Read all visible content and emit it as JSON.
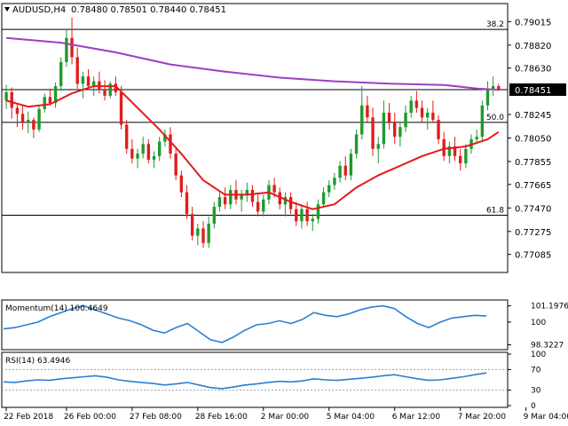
{
  "chart_data": {
    "type": "candlestick",
    "symbol_label": "AUDUSD,H4",
    "ohlc_label": "0.78480 0.78501 0.78440 0.78451",
    "colors": {
      "bull": "#1f9a2e",
      "bear": "#e11d1d",
      "ma_fast": "#e31b1b",
      "ma_slow": "#9b3fc6",
      "momentum": "#2b7fd4",
      "rsi": "#2b7fd4",
      "current_price_box": "#000000"
    },
    "price_axis": {
      "range": [
        0.7695,
        0.7915
      ],
      "ticks": [
        "0.79015",
        "0.78820",
        "0.78630",
        "0.78451",
        "0.78245",
        "0.78050",
        "0.77855",
        "0.77665",
        "0.77470",
        "0.77275",
        "0.77085"
      ],
      "tick_values": [
        0.79015,
        0.7882,
        0.7863,
        0.78451,
        0.78245,
        0.7805,
        0.77855,
        0.77665,
        0.7747,
        0.77275,
        0.77085
      ],
      "current_price": 0.78451
    },
    "fib_levels": [
      {
        "label": "38.2",
        "value": 0.7895
      },
      {
        "label": "50.0",
        "value": 0.7818
      },
      {
        "label": "61.8",
        "value": 0.7741
      }
    ],
    "time_axis": {
      "labels": [
        "22 Feb 2018",
        "26 Feb 00:00",
        "27 Feb 08:00",
        "28 Feb 16:00",
        "2 Mar 00:00",
        "5 Mar 04:00",
        "6 Mar 12:00",
        "7 Mar 20:00",
        "9 Mar 04:00"
      ],
      "label_index": [
        0,
        11,
        23,
        35,
        47,
        59,
        71,
        83,
        95
      ]
    },
    "candles": [
      [
        0.7836,
        0.7849,
        0.7829,
        0.7843
      ],
      [
        0.7843,
        0.7847,
        0.7821,
        0.783
      ],
      [
        0.783,
        0.7834,
        0.7814,
        0.7825
      ],
      [
        0.7825,
        0.7832,
        0.7812,
        0.7818
      ],
      [
        0.7818,
        0.7827,
        0.7809,
        0.782
      ],
      [
        0.782,
        0.7822,
        0.7805,
        0.7812
      ],
      [
        0.7812,
        0.7832,
        0.781,
        0.7829
      ],
      [
        0.7829,
        0.7842,
        0.7826,
        0.7839
      ],
      [
        0.7839,
        0.7846,
        0.7832,
        0.7834
      ],
      [
        0.7834,
        0.7851,
        0.783,
        0.7848
      ],
      [
        0.7848,
        0.7872,
        0.7844,
        0.7868
      ],
      [
        0.7868,
        0.7895,
        0.7864,
        0.7888
      ],
      [
        0.7888,
        0.7905,
        0.7866,
        0.7872
      ],
      [
        0.7872,
        0.788,
        0.7846,
        0.785
      ],
      [
        0.785,
        0.786,
        0.7838,
        0.7856
      ],
      [
        0.7856,
        0.7862,
        0.7845,
        0.7848
      ],
      [
        0.7848,
        0.7856,
        0.784,
        0.7852
      ],
      [
        0.7852,
        0.786,
        0.7842,
        0.7845
      ],
      [
        0.7845,
        0.7853,
        0.7836,
        0.784
      ],
      [
        0.784,
        0.7852,
        0.7838,
        0.785
      ],
      [
        0.785,
        0.7856,
        0.784,
        0.7843
      ],
      [
        0.7843,
        0.7848,
        0.7812,
        0.7816
      ],
      [
        0.7816,
        0.782,
        0.7792,
        0.7796
      ],
      [
        0.7796,
        0.7804,
        0.7784,
        0.7788
      ],
      [
        0.7788,
        0.7796,
        0.778,
        0.7792
      ],
      [
        0.7792,
        0.7806,
        0.7788,
        0.78
      ],
      [
        0.78,
        0.7804,
        0.7784,
        0.7787
      ],
      [
        0.7787,
        0.7794,
        0.778,
        0.779
      ],
      [
        0.779,
        0.7806,
        0.7786,
        0.7802
      ],
      [
        0.7802,
        0.7812,
        0.7798,
        0.7808
      ],
      [
        0.7808,
        0.7814,
        0.7788,
        0.7792
      ],
      [
        0.7792,
        0.7796,
        0.777,
        0.7774
      ],
      [
        0.7774,
        0.7778,
        0.7756,
        0.776
      ],
      [
        0.776,
        0.7766,
        0.7738,
        0.7742
      ],
      [
        0.7742,
        0.7748,
        0.772,
        0.7724
      ],
      [
        0.7724,
        0.7734,
        0.7716,
        0.773
      ],
      [
        0.773,
        0.7736,
        0.7714,
        0.7718
      ],
      [
        0.7718,
        0.774,
        0.7714,
        0.7734
      ],
      [
        0.7734,
        0.7752,
        0.773,
        0.7748
      ],
      [
        0.7748,
        0.776,
        0.7744,
        0.7756
      ],
      [
        0.7756,
        0.7764,
        0.7746,
        0.775
      ],
      [
        0.775,
        0.7766,
        0.7746,
        0.7762
      ],
      [
        0.7762,
        0.777,
        0.775,
        0.7754
      ],
      [
        0.7754,
        0.7762,
        0.7744,
        0.7758
      ],
      [
        0.7758,
        0.7768,
        0.7752,
        0.7762
      ],
      [
        0.7762,
        0.7766,
        0.7748,
        0.7752
      ],
      [
        0.7752,
        0.7758,
        0.774,
        0.7744
      ],
      [
        0.7744,
        0.7758,
        0.774,
        0.7754
      ],
      [
        0.7754,
        0.777,
        0.775,
        0.7766
      ],
      [
        0.7766,
        0.7772,
        0.7756,
        0.776
      ],
      [
        0.776,
        0.7764,
        0.7746,
        0.775
      ],
      [
        0.775,
        0.776,
        0.774,
        0.7756
      ],
      [
        0.7756,
        0.776,
        0.7742,
        0.7746
      ],
      [
        0.7746,
        0.7752,
        0.7732,
        0.7736
      ],
      [
        0.7736,
        0.775,
        0.773,
        0.7746
      ],
      [
        0.7746,
        0.7752,
        0.7732,
        0.7736
      ],
      [
        0.7736,
        0.7742,
        0.7728,
        0.7738
      ],
      [
        0.7738,
        0.7754,
        0.7734,
        0.775
      ],
      [
        0.775,
        0.7764,
        0.7748,
        0.776
      ],
      [
        0.776,
        0.777,
        0.7756,
        0.7766
      ],
      [
        0.7766,
        0.7776,
        0.7762,
        0.7772
      ],
      [
        0.7772,
        0.7786,
        0.7768,
        0.7782
      ],
      [
        0.7782,
        0.779,
        0.777,
        0.7774
      ],
      [
        0.7774,
        0.7796,
        0.777,
        0.7792
      ],
      [
        0.7792,
        0.7812,
        0.7788,
        0.7808
      ],
      [
        0.7808,
        0.7848,
        0.7804,
        0.7832
      ],
      [
        0.7832,
        0.784,
        0.7818,
        0.7822
      ],
      [
        0.7822,
        0.783,
        0.779,
        0.7796
      ],
      [
        0.7796,
        0.7806,
        0.7784,
        0.78
      ],
      [
        0.78,
        0.7836,
        0.7796,
        0.7826
      ],
      [
        0.7826,
        0.7834,
        0.7812,
        0.7818
      ],
      [
        0.7818,
        0.7826,
        0.78,
        0.7806
      ],
      [
        0.7806,
        0.7818,
        0.7798,
        0.7814
      ],
      [
        0.7814,
        0.7832,
        0.781,
        0.7826
      ],
      [
        0.7826,
        0.784,
        0.7822,
        0.7836
      ],
      [
        0.7836,
        0.7844,
        0.7826,
        0.783
      ],
      [
        0.783,
        0.7836,
        0.7818,
        0.7822
      ],
      [
        0.7822,
        0.783,
        0.7812,
        0.7826
      ],
      [
        0.7826,
        0.7836,
        0.7818,
        0.782
      ],
      [
        0.782,
        0.7824,
        0.78,
        0.7804
      ],
      [
        0.7804,
        0.781,
        0.7786,
        0.779
      ],
      [
        0.779,
        0.7802,
        0.7784,
        0.7798
      ],
      [
        0.7798,
        0.7806,
        0.7786,
        0.779
      ],
      [
        0.779,
        0.7796,
        0.7778,
        0.7784
      ],
      [
        0.7784,
        0.78,
        0.778,
        0.7796
      ],
      [
        0.7796,
        0.7808,
        0.7792,
        0.7804
      ],
      [
        0.7804,
        0.7812,
        0.78,
        0.7806
      ],
      [
        0.7806,
        0.7836,
        0.7802,
        0.7832
      ],
      [
        0.7832,
        0.7852,
        0.7828,
        0.7846
      ],
      [
        0.7846,
        0.7856,
        0.784,
        0.7848
      ],
      [
        0.7848,
        0.78501,
        0.7844,
        0.78451
      ]
    ],
    "ma_fast": {
      "period_note": "",
      "points": [
        [
          0,
          0.7836
        ],
        [
          4,
          0.7831
        ],
        [
          8,
          0.7833
        ],
        [
          12,
          0.7842
        ],
        [
          16,
          0.7848
        ],
        [
          20,
          0.7848
        ],
        [
          24,
          0.783
        ],
        [
          28,
          0.7812
        ],
        [
          32,
          0.7792
        ],
        [
          36,
          0.777
        ],
        [
          40,
          0.7758
        ],
        [
          44,
          0.7758
        ],
        [
          48,
          0.776
        ],
        [
          52,
          0.7752
        ],
        [
          56,
          0.7746
        ],
        [
          60,
          0.775
        ],
        [
          64,
          0.7764
        ],
        [
          68,
          0.7774
        ],
        [
          72,
          0.7782
        ],
        [
          76,
          0.779
        ],
        [
          80,
          0.7796
        ],
        [
          84,
          0.7798
        ],
        [
          88,
          0.7804
        ],
        [
          90,
          0.781
        ]
      ]
    },
    "ma_slow": {
      "points": [
        [
          0,
          0.7888
        ],
        [
          10,
          0.7884
        ],
        [
          20,
          0.7876
        ],
        [
          30,
          0.7866
        ],
        [
          40,
          0.786
        ],
        [
          50,
          0.7855
        ],
        [
          60,
          0.7852
        ],
        [
          70,
          0.785
        ],
        [
          80,
          0.7849
        ],
        [
          86,
          0.7846
        ],
        [
          90,
          0.7845
        ]
      ]
    },
    "momentum": {
      "label": "Momentum(14) 100.4649",
      "axis_ticks": [
        "101.1976",
        "100",
        "98.3227"
      ],
      "tick_values": [
        101.1976,
        100,
        98.3227
      ],
      "range": [
        98.1,
        101.5
      ],
      "values": [
        99.5,
        99.6,
        99.8,
        100.0,
        100.4,
        100.7,
        101.0,
        101.2,
        100.9,
        100.6,
        100.3,
        100.1,
        99.8,
        99.4,
        99.2,
        99.6,
        99.9,
        99.3,
        98.7,
        98.5,
        98.9,
        99.4,
        99.8,
        99.9,
        100.1,
        99.9,
        100.2,
        100.7,
        100.5,
        100.4,
        100.6,
        100.9,
        101.1,
        101.2,
        101.0,
        100.4,
        99.9,
        99.6,
        100.0,
        100.3,
        100.4,
        100.5,
        100.45
      ]
    },
    "rsi": {
      "label": "RSI(14) 63.4946",
      "axis_ticks": [
        "100",
        "70",
        "30",
        "0"
      ],
      "tick_values": [
        100,
        70,
        30,
        0
      ],
      "range": [
        0,
        100
      ],
      "values": [
        46,
        45,
        48,
        50,
        49,
        52,
        54,
        56,
        58,
        55,
        50,
        47,
        45,
        43,
        40,
        42,
        45,
        40,
        35,
        33,
        36,
        40,
        42,
        45,
        47,
        46,
        48,
        52,
        50,
        49,
        51,
        53,
        55,
        58,
        60,
        56,
        52,
        49,
        50,
        53,
        56,
        60,
        63.5
      ]
    }
  }
}
